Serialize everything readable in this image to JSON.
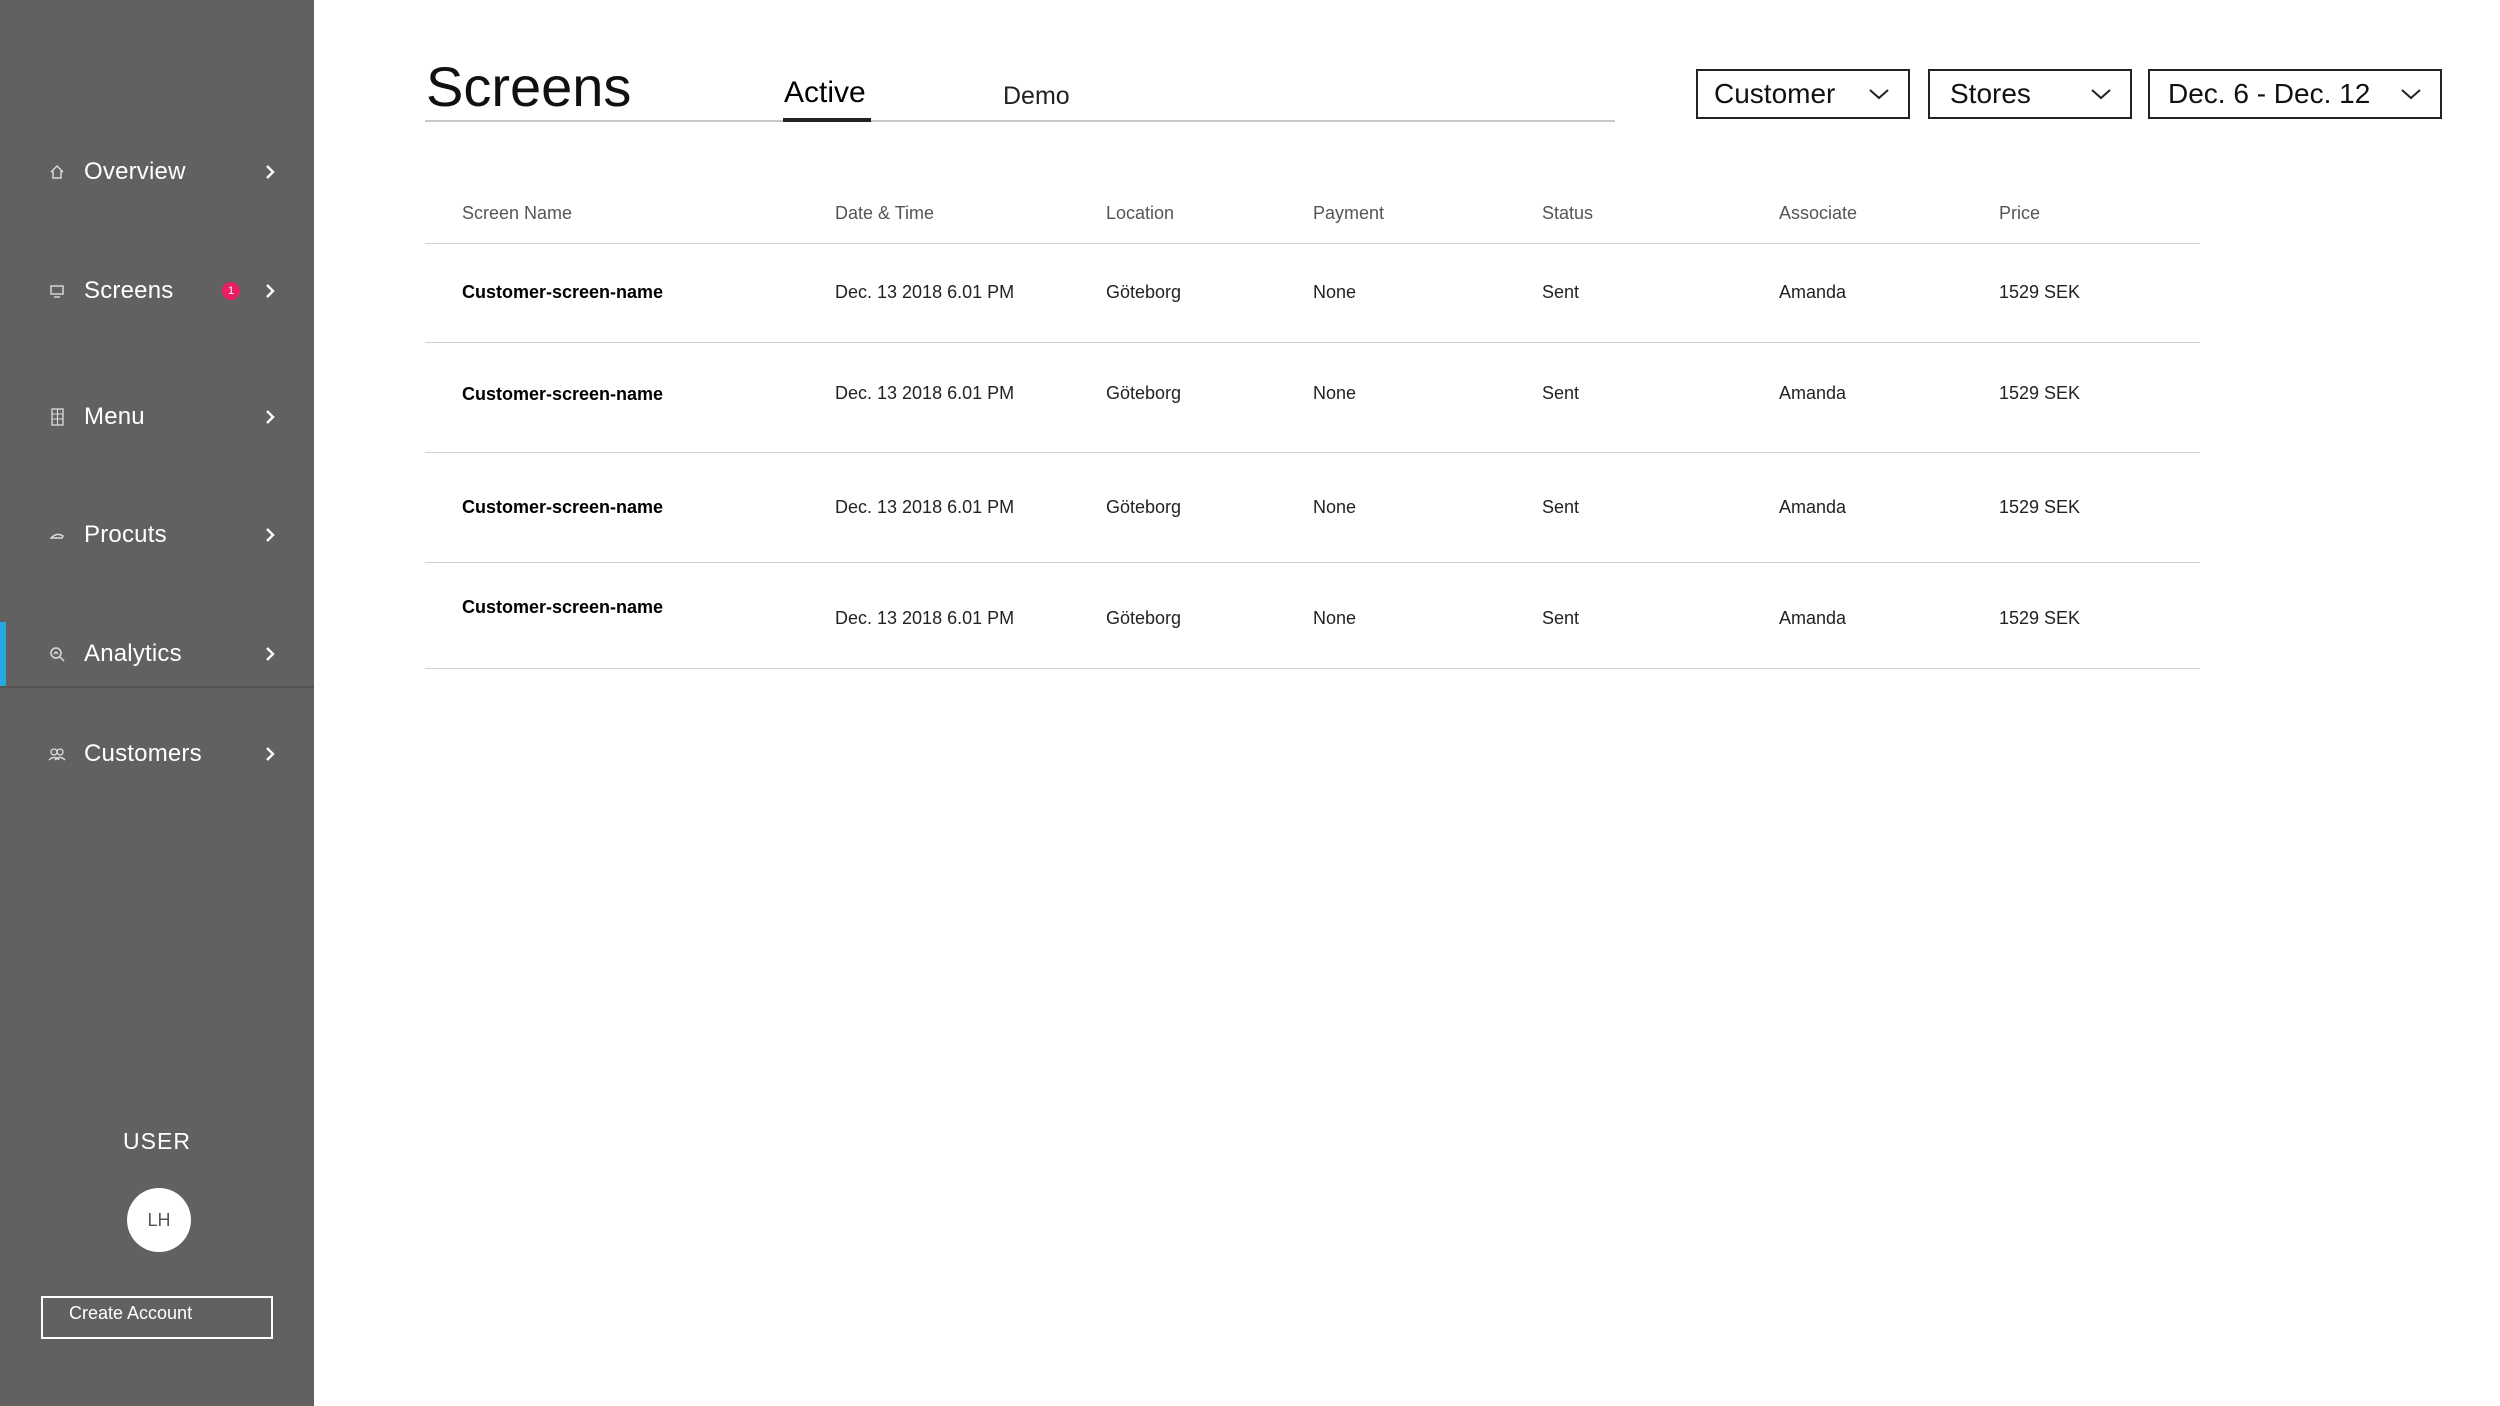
{
  "sidebar": {
    "items": [
      {
        "label": "Overview",
        "icon": "home-icon"
      },
      {
        "label": "Screens",
        "icon": "monitor-icon",
        "badge": "1"
      },
      {
        "label": "Menu",
        "icon": "menu-grid-icon"
      },
      {
        "label": "Procuts",
        "icon": "product-icon"
      },
      {
        "label": "Analytics",
        "icon": "analytics-icon",
        "active": true
      },
      {
        "label": "Customers",
        "icon": "customers-icon"
      }
    ],
    "user_label": "USER",
    "avatar_initials": "LH",
    "create_account": "Create Account",
    "accent_color": "#29a8e0",
    "badge_color": "#e91e63"
  },
  "header": {
    "title": "Screens",
    "tabs": [
      {
        "label": "Active",
        "active": true
      },
      {
        "label": "Demo",
        "active": false
      }
    ],
    "filters": {
      "customer": "Customer",
      "stores": "Stores",
      "date_range": "Dec. 6 - Dec. 12"
    }
  },
  "table": {
    "columns": [
      "Screen Name",
      "Date & Time",
      "Location",
      "Payment",
      "Status",
      "Associate",
      "Price"
    ],
    "rows": [
      {
        "name": "Customer-screen-name",
        "datetime": "Dec. 13 2018  6.01 PM",
        "location": "Göteborg",
        "payment": "None",
        "status": "Sent",
        "associate": "Amanda",
        "price": "1529 SEK"
      },
      {
        "name": "Customer-screen-name",
        "datetime": "Dec. 13 2018  6.01 PM",
        "location": "Göteborg",
        "payment": "None",
        "status": "Sent",
        "associate": "Amanda",
        "price": "1529 SEK"
      },
      {
        "name": "Customer-screen-name",
        "datetime": "Dec. 13 2018  6.01 PM",
        "location": "Göteborg",
        "payment": "None",
        "status": "Sent",
        "associate": "Amanda",
        "price": "1529 SEK"
      },
      {
        "name": "Customer-screen-name",
        "datetime": "Dec. 13 2018  6.01 PM",
        "location": "Göteborg",
        "payment": "None",
        "status": "Sent",
        "associate": "Amanda",
        "price": "1529 SEK"
      }
    ]
  }
}
